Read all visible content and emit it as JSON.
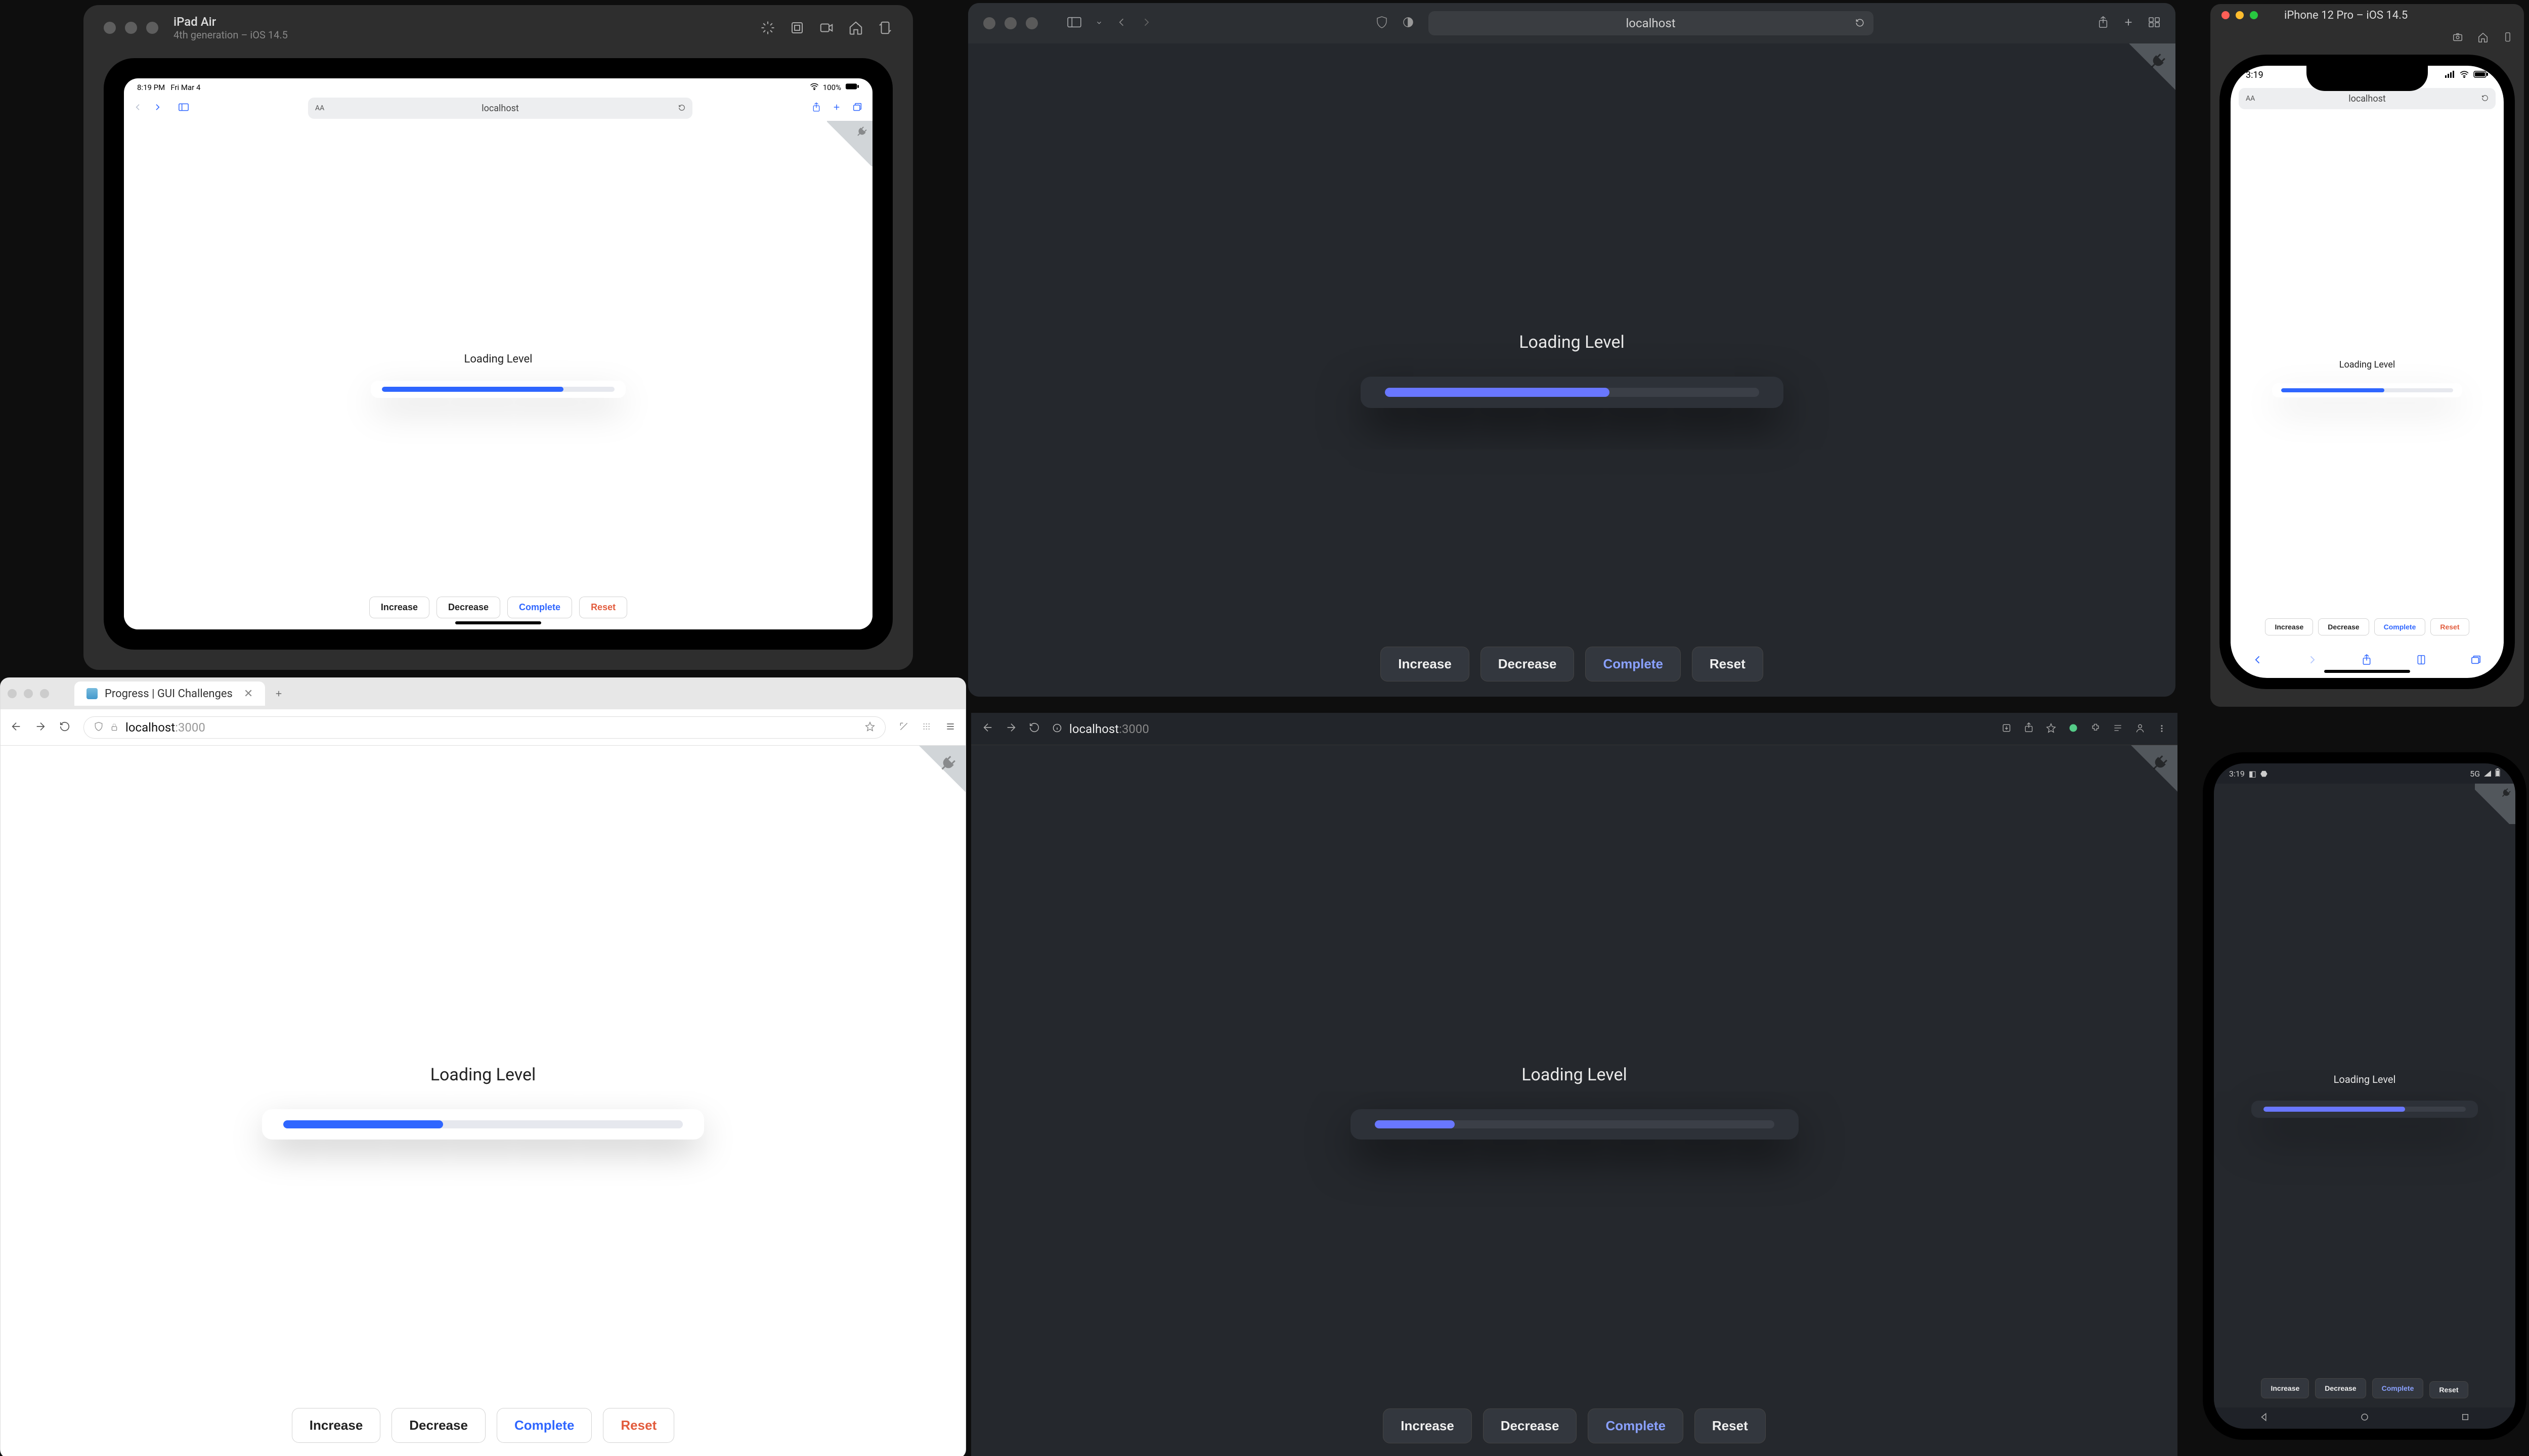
{
  "app": {
    "loading_label": "Loading Level",
    "buttons": {
      "increase": "Increase",
      "decrease": "Decrease",
      "complete": "Complete",
      "reset": "Reset"
    }
  },
  "addresses": {
    "localhost": "localhost",
    "localhost_port": "localhost:3000"
  },
  "simulators": {
    "ipad": {
      "title": "iPad Air",
      "subtitle": "4th generation – iOS 14.5",
      "status_time": "8:19 PM",
      "status_date": "Fri Mar 4",
      "status_battery": "100%"
    },
    "iphone": {
      "title": "iPhone 12 Pro – iOS 14.5",
      "status_time": "3:19"
    },
    "android": {
      "status_time": "3:19",
      "status_net": "5G"
    }
  },
  "browser_light": {
    "tab_title": "Progress | GUI Challenges"
  },
  "progress_values": {
    "ipad": 78,
    "safari_big": 60,
    "iphone": 60,
    "browser_light": 40,
    "browser_dark": 20,
    "android": 70
  },
  "colors": {
    "accent_blue_light": "#2f66ff",
    "accent_blue_dark": "#6977ff",
    "reset_red": "#e25b3c"
  }
}
